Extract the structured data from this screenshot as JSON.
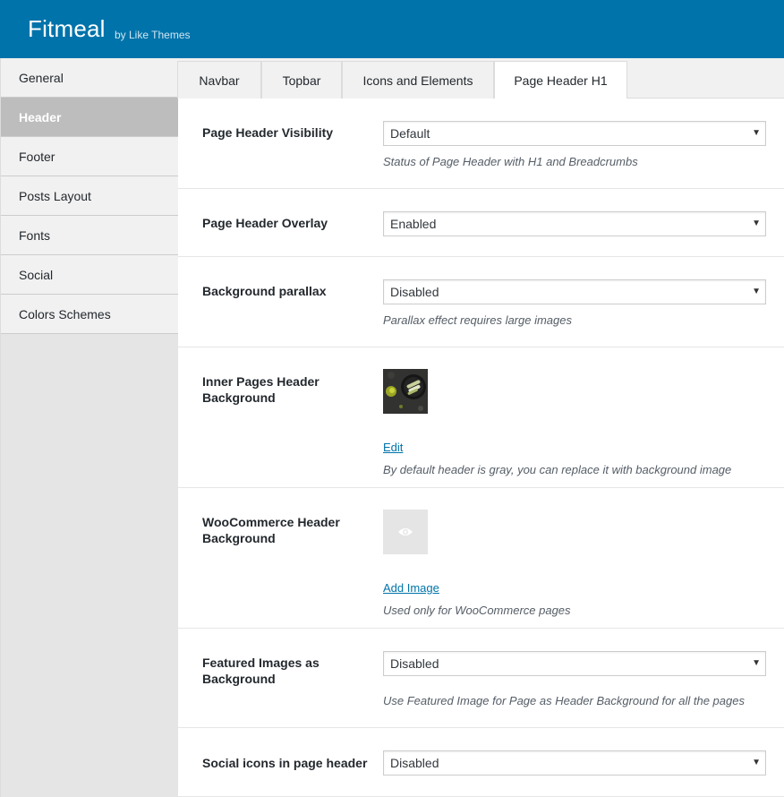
{
  "header": {
    "title": "Fitmeal",
    "subtitle": "by Like Themes",
    "bg_color": "#0073aa"
  },
  "sidebar": {
    "items": [
      {
        "label": "General"
      },
      {
        "label": "Header",
        "active": true
      },
      {
        "label": "Footer"
      },
      {
        "label": "Posts Layout"
      },
      {
        "label": "Fonts"
      },
      {
        "label": "Social"
      },
      {
        "label": "Colors Schemes"
      }
    ]
  },
  "tabs": [
    {
      "label": "Navbar"
    },
    {
      "label": "Topbar"
    },
    {
      "label": "Icons and Elements"
    },
    {
      "label": "Page Header H1",
      "active": true
    }
  ],
  "settings": {
    "visibility": {
      "label": "Page Header Visibility",
      "value": "Default",
      "description": "Status of Page Header with H1 and Breadcrumbs"
    },
    "overlay": {
      "label": "Page Header Overlay",
      "value": "Enabled"
    },
    "parallax": {
      "label": "Background parallax",
      "value": "Disabled",
      "description": "Parallax effect requires large images"
    },
    "inner_bg": {
      "label": "Inner Pages Header Background",
      "link": "Edit",
      "description": "By default header is gray, you can replace it with background image"
    },
    "woo_bg": {
      "label": "WooCommerce Header Background",
      "link": "Add Image",
      "description": "Used only for WooCommerce pages"
    },
    "featured": {
      "label": "Featured Images as Background",
      "value": "Disabled",
      "description": "Use Featured Image for Page as Header Background for all the pages"
    },
    "social": {
      "label": "Social icons in page header",
      "value": "Disabled"
    }
  },
  "icons": {
    "select_arrow": "triangle-down-icon",
    "placeholder_eye": "eye-icon"
  }
}
